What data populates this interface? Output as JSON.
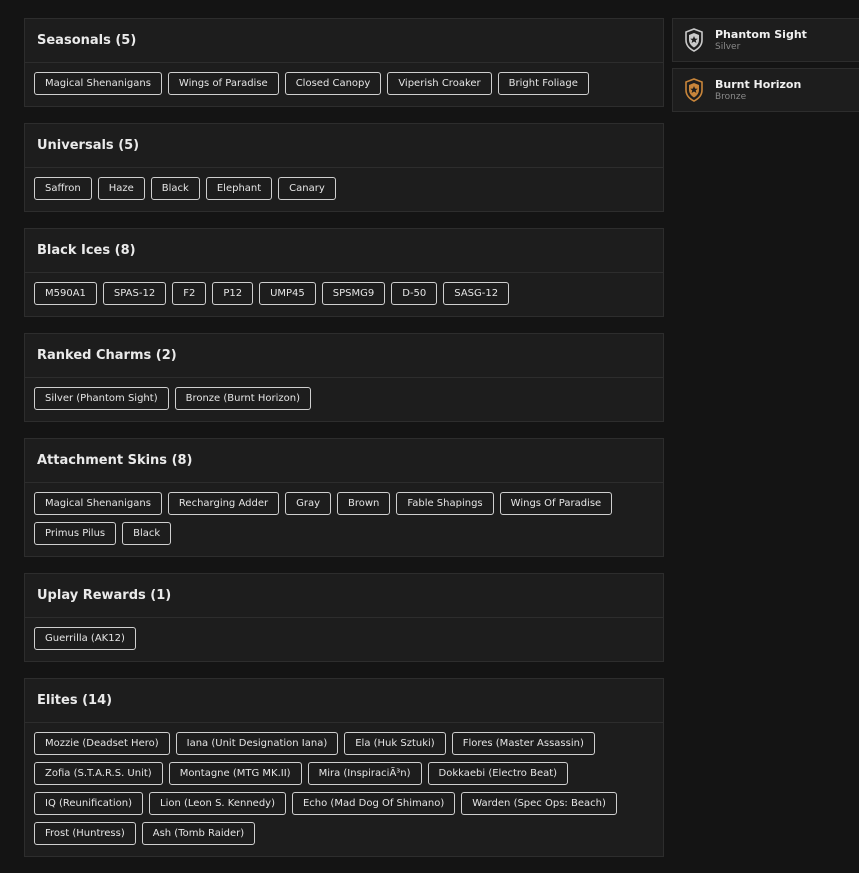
{
  "sections": [
    {
      "title": "Seasonals (5)",
      "items": [
        "Magical Shenanigans",
        "Wings of Paradise",
        "Closed Canopy",
        "Viperish Croaker",
        "Bright Foliage"
      ]
    },
    {
      "title": "Universals (5)",
      "items": [
        "Saffron",
        "Haze",
        "Black",
        "Elephant",
        "Canary"
      ]
    },
    {
      "title": "Black Ices (8)",
      "items": [
        "M590A1",
        "SPAS-12",
        "F2",
        "P12",
        "UMP45",
        "SPSMG9",
        "D-50",
        "SASG-12"
      ]
    },
    {
      "title": "Ranked Charms (2)",
      "items": [
        "Silver (Phantom Sight)",
        "Bronze (Burnt Horizon)"
      ]
    },
    {
      "title": "Attachment Skins (8)",
      "items": [
        "Magical Shenanigans",
        "Recharging Adder",
        "Gray",
        "Brown",
        "Fable Shapings",
        "Wings Of Paradise",
        "Primus Pilus",
        "Black"
      ]
    },
    {
      "title": "Uplay Rewards (1)",
      "items": [
        "Guerrilla (AK12)"
      ]
    },
    {
      "title": "Elites (14)",
      "items": [
        "Mozzie (Deadset Hero)",
        "Iana (Unit Designation Iana)",
        "Ela (Huk Sztuki)",
        "Flores (Master Assassin)",
        "Zofia (S.T.A.R.S. Unit)",
        "Montagne (MTG MK.II)",
        "Mira (InspiraciÃ³n)",
        "Dokkaebi (Electro Beat)",
        "IQ (Reunification)",
        "Lion (Leon S. Kennedy)",
        "Echo (Mad Dog Of Shimano)",
        "Warden (Spec Ops: Beach)",
        "Frost (Huntress)",
        "Ash (Tomb Raider)"
      ]
    }
  ],
  "ranks": [
    {
      "name": "Phantom Sight",
      "tier": "Silver",
      "icon": "silver-rank-badge-icon",
      "color": "#c9c9c9"
    },
    {
      "name": "Burnt Horizon",
      "tier": "Bronze",
      "icon": "bronze-rank-badge-icon",
      "color": "#c8853a"
    }
  ]
}
